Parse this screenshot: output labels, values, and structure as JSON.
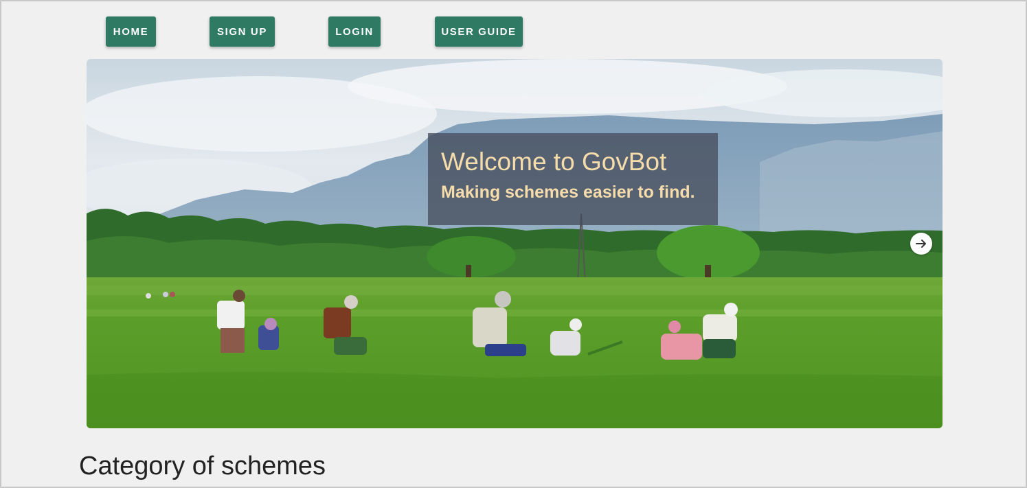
{
  "nav": {
    "home": "HOME",
    "signup": "SIGN UP",
    "login": "LOGIN",
    "user_guide": "USER GUIDE"
  },
  "hero": {
    "title": "Welcome to GovBot",
    "subtitle": "Making schemes easier to find.",
    "next_icon": "arrow-right-icon"
  },
  "section": {
    "heading": "Category of schemes"
  },
  "colors": {
    "nav_button": "#2e7a62",
    "caption_text": "#f5dcaa",
    "background": "#f0f0f0"
  }
}
